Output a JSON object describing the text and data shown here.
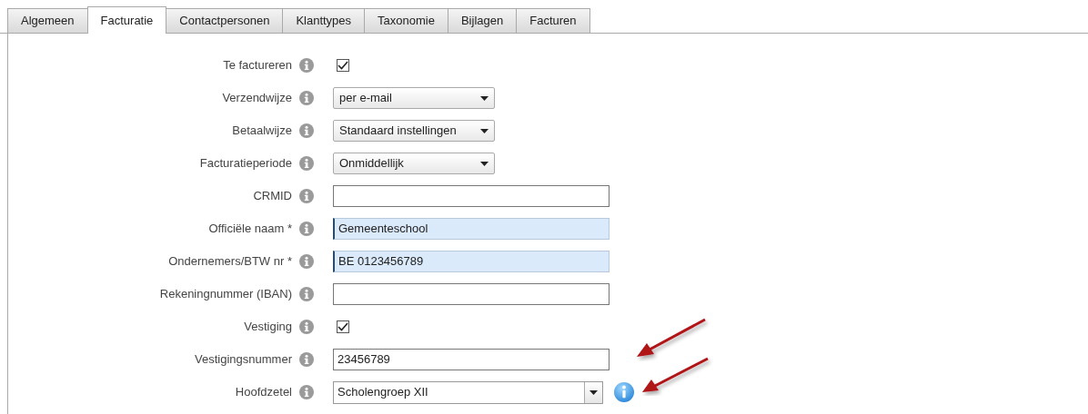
{
  "tabs": [
    {
      "label": "Algemeen",
      "selected": false
    },
    {
      "label": "Facturatie",
      "selected": true
    },
    {
      "label": "Contactpersonen",
      "selected": false
    },
    {
      "label": "Klanttypes",
      "selected": false
    },
    {
      "label": "Taxonomie",
      "selected": false
    },
    {
      "label": "Bijlagen",
      "selected": false
    },
    {
      "label": "Facturen",
      "selected": false
    }
  ],
  "fields": [
    {
      "label": "Te factureren",
      "kind": "checkbox",
      "checked": true
    },
    {
      "label": "Verzendwijze",
      "kind": "select",
      "value": "per e-mail"
    },
    {
      "label": "Betaalwijze",
      "kind": "select",
      "value": "Standaard instellingen"
    },
    {
      "label": "Facturatieperiode",
      "kind": "select",
      "value": "Onmiddellijk"
    },
    {
      "label": "CRMID",
      "kind": "text",
      "highlighted": false
    },
    {
      "label": "Officiële naam *",
      "kind": "text",
      "value": "Gemeenteschool",
      "highlighted": true
    },
    {
      "label": "Ondernemers/BTW nr *",
      "kind": "text",
      "value": "BE 0123456789",
      "highlighted": true
    },
    {
      "label": "Rekeningnummer (IBAN)",
      "kind": "text",
      "highlighted": false
    },
    {
      "label": "Vestiging",
      "kind": "checkbox",
      "checked": true
    },
    {
      "label": "Vestigingsnummer",
      "kind": "text",
      "value": "23456789",
      "highlighted": false
    },
    {
      "label": "Hoofdzetel",
      "kind": "combo",
      "value": "Scholengroep XII"
    }
  ]
}
